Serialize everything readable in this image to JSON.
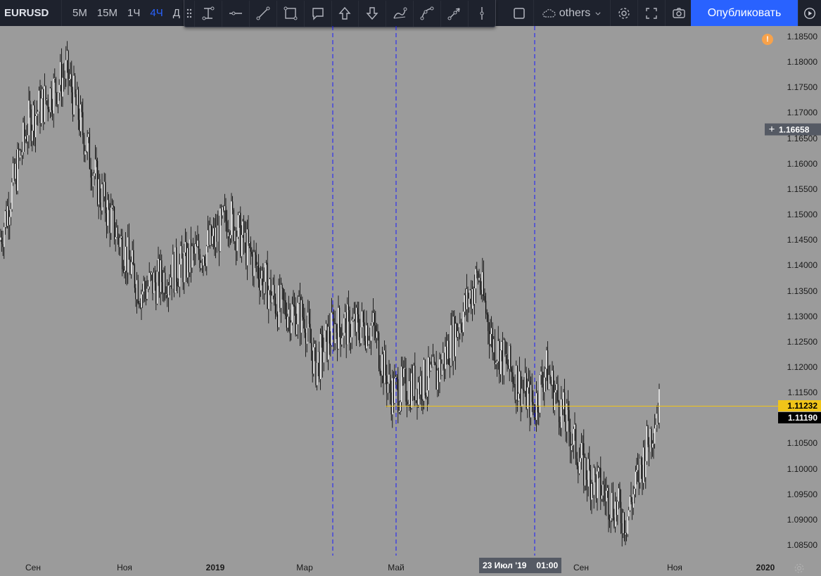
{
  "header": {
    "symbol": "EURUSD",
    "intervals": [
      "5M",
      "15M",
      "1Ч",
      "4Ч",
      "Д"
    ],
    "active_interval": "4Ч",
    "others_label": "others",
    "publish_label": "Опубликовать"
  },
  "drawing_tools": [
    "text-cursor-icon",
    "horizontal-line-icon",
    "trend-line-icon",
    "rectangle-icon",
    "callout-icon",
    "arrow-up-icon",
    "arrow-down-icon",
    "path-icon",
    "curve-icon",
    "ray-icon",
    "vertical-line-icon"
  ],
  "colors": {
    "chart_background": "#9b9b9b",
    "candle": "#000000",
    "horizontal_line": "#f0c419",
    "vertical_line": "#1a1aff",
    "accent": "#2962ff",
    "toolbar_bg": "#1e222d"
  },
  "price_scale": {
    "ticks": [
      "1.18500",
      "1.18000",
      "1.17500",
      "1.17000",
      "1.16500",
      "1.16000",
      "1.15500",
      "1.15000",
      "1.14500",
      "1.14000",
      "1.13500",
      "1.13000",
      "1.12500",
      "1.12000",
      "1.11500",
      "1.10500",
      "1.10000",
      "1.09500",
      "1.09000",
      "1.08500"
    ],
    "crosshair_price": "1.16658",
    "line_price": "1.11232",
    "last_price": "1.11190"
  },
  "time_scale": {
    "ticks": [
      "Сен",
      "Ноя",
      "2019",
      "Мар",
      "Май",
      "Сен",
      "Ноя",
      "2020"
    ],
    "crosshair_date": "23 Июл '19",
    "crosshair_time": "01:00"
  },
  "alert_icon": "!",
  "chart_data": {
    "type": "candlestick",
    "symbol": "EURUSD",
    "interval": "4Ч",
    "ylim": [
      1.0845,
      1.1878
    ],
    "x_months": [
      "Сен 2018",
      "Ноя 2018",
      "2019",
      "Мар 2019",
      "Май 2019",
      "Июл 2019",
      "Сен 2019",
      "Ноя 2019"
    ],
    "approx_close_path": [
      [
        "Авг 2018",
        1.145
      ],
      [
        "Сен 2018",
        1.168
      ],
      [
        "Окт 2018",
        1.178
      ],
      [
        "Окт 2018",
        1.155
      ],
      [
        "Ноя 2018",
        1.135
      ],
      [
        "Дек 2018",
        1.14
      ],
      [
        "2019",
        1.145
      ],
      [
        "Янв 2019",
        1.15
      ],
      [
        "Фев 2019",
        1.132
      ],
      [
        "Мар 2019",
        1.13
      ],
      [
        "Мар 2019",
        1.12
      ],
      [
        "Апр 2019",
        1.128
      ],
      [
        "Апр 2019",
        1.128
      ],
      [
        "Май 2019",
        1.115
      ],
      [
        "Июн 2019",
        1.118
      ],
      [
        "Июл 2019",
        1.138
      ],
      [
        "Июл 2019",
        1.125
      ],
      [
        "Авг 2019",
        1.112
      ],
      [
        "Авг 2019",
        1.12
      ],
      [
        "Сен 2019",
        1.1
      ],
      [
        "Окт 2019",
        1.09
      ],
      [
        "Окт 2019",
        1.112
      ]
    ],
    "horizontal_line": 1.11232,
    "last_price": 1.1119,
    "vertical_lines_count": 3
  }
}
